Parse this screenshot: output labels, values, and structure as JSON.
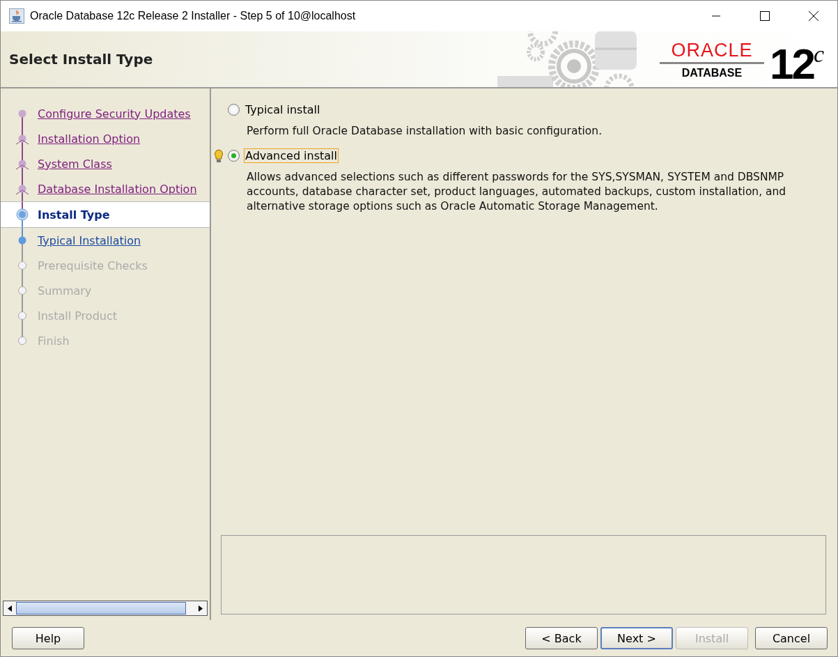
{
  "window": {
    "title": "Oracle Database 12c Release 2 Installer - Step 5 of 10@localhost"
  },
  "header": {
    "title": "Select Install Type",
    "logo": {
      "brand": "ORACLE",
      "product": "DATABASE",
      "version": "12",
      "version_sup": "c"
    }
  },
  "steps": [
    {
      "label": "Configure Security Updates",
      "kind": "done",
      "selected": false
    },
    {
      "label": "Installation Option",
      "kind": "done",
      "selected": false
    },
    {
      "label": "System Class",
      "kind": "done",
      "selected": false
    },
    {
      "label": "Database Installation Option",
      "kind": "done",
      "selected": false
    },
    {
      "label": "Install Type",
      "kind": "current",
      "selected": true
    },
    {
      "label": "Typical Installation",
      "kind": "next",
      "selected": false
    },
    {
      "label": "Prerequisite Checks",
      "kind": "pending",
      "selected": false
    },
    {
      "label": "Summary",
      "kind": "pending",
      "selected": false
    },
    {
      "label": "Install Product",
      "kind": "pending",
      "selected": false
    },
    {
      "label": "Finish",
      "kind": "pending",
      "selected": false
    }
  ],
  "options": [
    {
      "label": "Typical install",
      "selected": false,
      "focused": false,
      "description": "Perform full Oracle Database installation with basic configuration."
    },
    {
      "label": "Advanced install",
      "selected": true,
      "focused": true,
      "description": "Allows advanced selections such as different passwords for the SYS,SYSMAN, SYSTEM and DBSNMP accounts, database character set, product languages, automated backups, custom installation, and alternative storage options such as Oracle Automatic Storage Management."
    }
  ],
  "buttons": [
    {
      "label": "Help",
      "disabled": false,
      "default": false
    },
    {
      "label": "< Back",
      "disabled": false,
      "default": false
    },
    {
      "label": "Next >",
      "disabled": false,
      "default": true
    },
    {
      "label": "Install",
      "disabled": true,
      "default": false
    },
    {
      "label": "Cancel",
      "disabled": false,
      "default": false
    }
  ]
}
